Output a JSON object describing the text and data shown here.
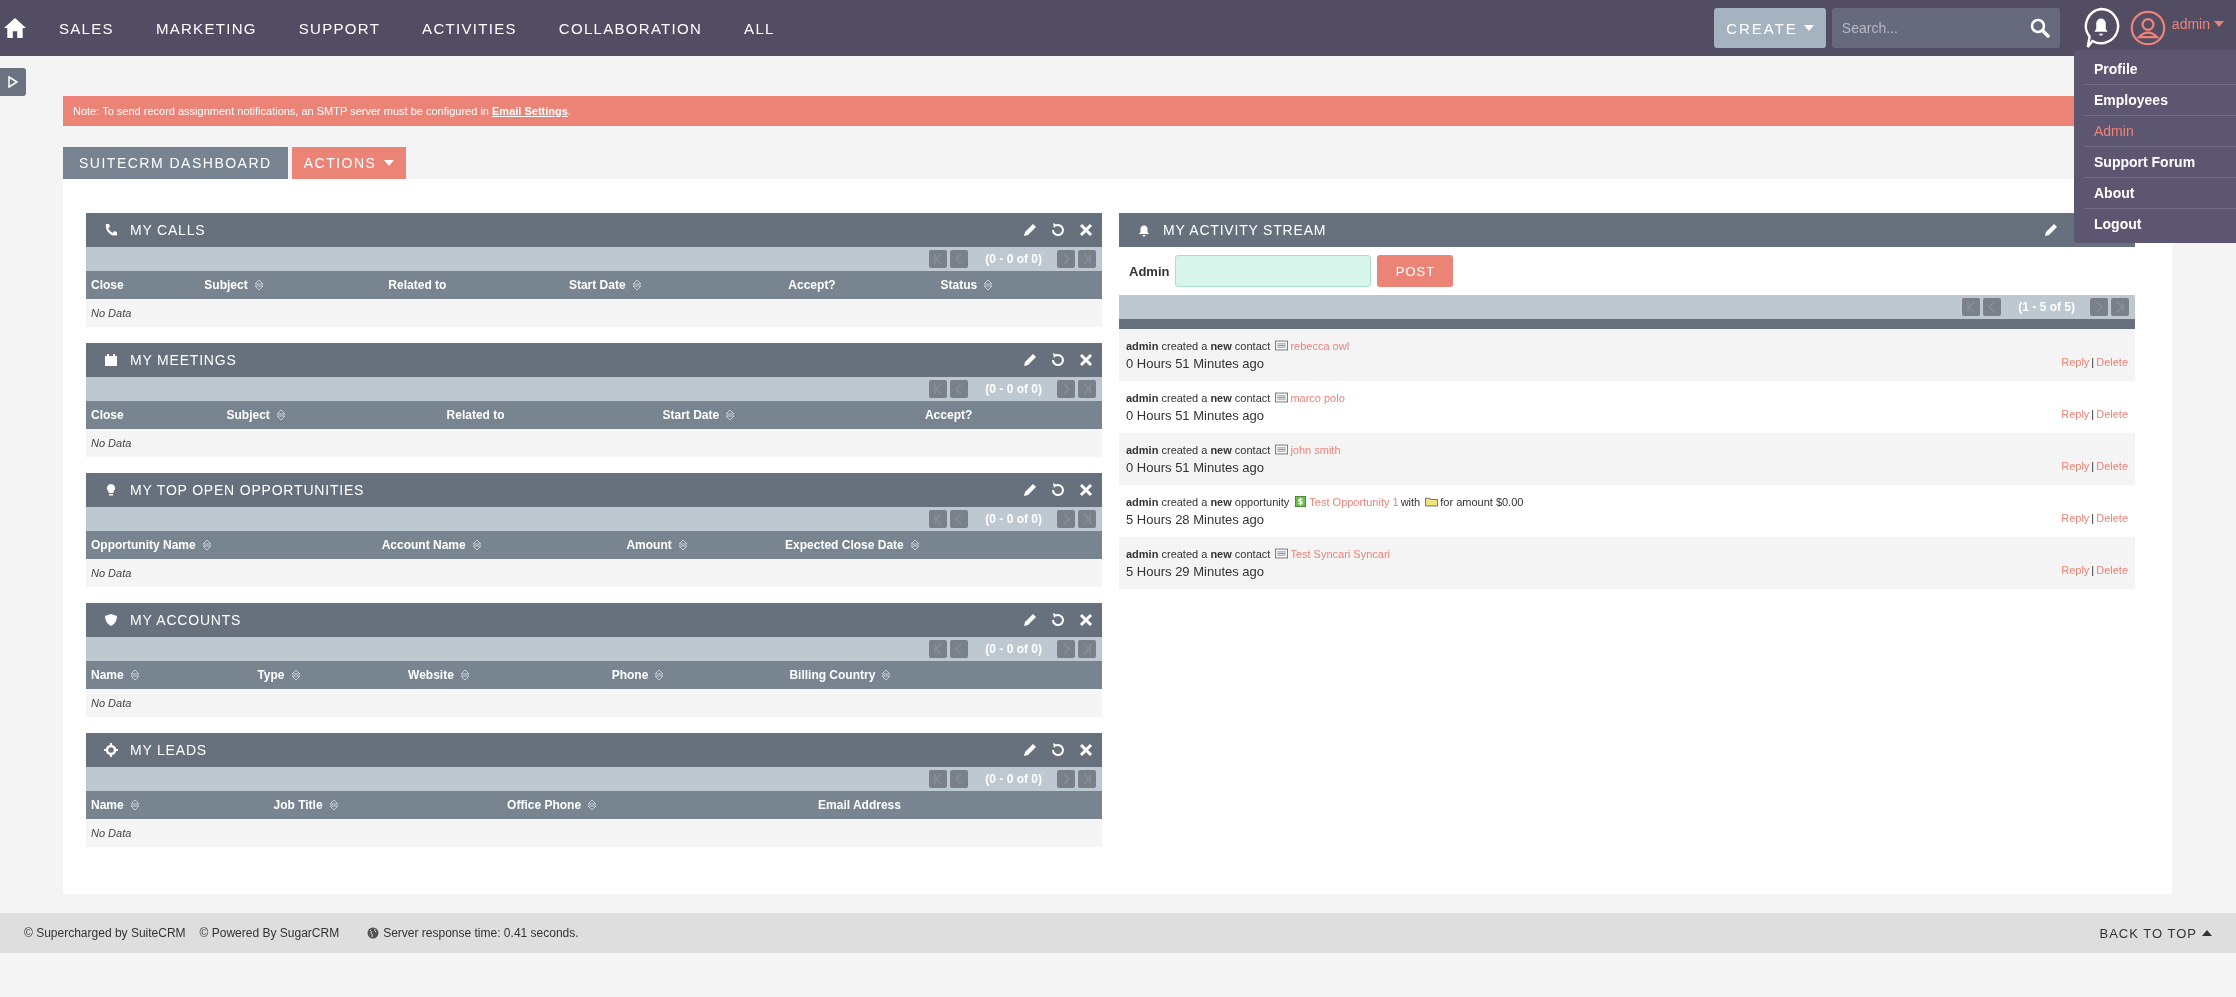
{
  "nav": {
    "items": [
      "SALES",
      "MARKETING",
      "SUPPORT",
      "ACTIVITIES",
      "COLLABORATION",
      "ALL"
    ],
    "create": "CREATE",
    "search_placeholder": "Search...",
    "user": "admin"
  },
  "user_menu": [
    {
      "label": "Profile",
      "selected": false
    },
    {
      "label": "Employees",
      "selected": false
    },
    {
      "label": "Admin",
      "selected": true
    },
    {
      "label": "Support Forum",
      "selected": false
    },
    {
      "label": "About",
      "selected": false
    },
    {
      "label": "Logout",
      "selected": false
    }
  ],
  "notice": {
    "text": "Note: To send record assignment notifications, an SMTP server must be configured in ",
    "link": "Email Settings",
    "after": "."
  },
  "dashboard_tabs": {
    "tab": "SUITECRM DASHBOARD",
    "actions": "ACTIONS"
  },
  "dashlets": [
    {
      "title": "MY CALLS",
      "pagination": "(0 - 0 of 0)",
      "columns": [
        {
          "label": "Close",
          "sortable": false
        },
        {
          "label": "Subject",
          "sortable": true
        },
        {
          "label": "Related to",
          "sortable": false
        },
        {
          "label": "Start Date",
          "sortable": true
        },
        {
          "label": "Accept?",
          "sortable": false
        },
        {
          "label": "Status",
          "sortable": true
        }
      ],
      "empty": "No Data"
    },
    {
      "title": "MY MEETINGS",
      "pagination": "(0 - 0 of 0)",
      "columns": [
        {
          "label": "Close",
          "sortable": false
        },
        {
          "label": "Subject",
          "sortable": true
        },
        {
          "label": "Related to",
          "sortable": false
        },
        {
          "label": "Start Date",
          "sortable": true
        },
        {
          "label": "Accept?",
          "sortable": false
        }
      ],
      "empty": "No Data"
    },
    {
      "title": "MY TOP OPEN OPPORTUNITIES",
      "pagination": "(0 - 0 of 0)",
      "columns": [
        {
          "label": "Opportunity Name",
          "sortable": true
        },
        {
          "label": "Account Name",
          "sortable": true
        },
        {
          "label": "Amount",
          "sortable": true
        },
        {
          "label": "Expected Close Date",
          "sortable": true
        }
      ],
      "empty": "No Data"
    },
    {
      "title": "MY ACCOUNTS",
      "pagination": "(0 - 0 of 0)",
      "columns": [
        {
          "label": "Name",
          "sortable": true
        },
        {
          "label": "Type",
          "sortable": true
        },
        {
          "label": "Website",
          "sortable": true
        },
        {
          "label": "Phone",
          "sortable": true
        },
        {
          "label": "Billing Country",
          "sortable": true
        }
      ],
      "empty": "No Data"
    },
    {
      "title": "MY LEADS",
      "pagination": "(0 - 0 of 0)",
      "columns": [
        {
          "label": "Name",
          "sortable": true
        },
        {
          "label": "Job Title",
          "sortable": true
        },
        {
          "label": "Office Phone",
          "sortable": true
        },
        {
          "label": "Email Address",
          "sortable": false
        }
      ],
      "empty": "No Data"
    }
  ],
  "activity_stream": {
    "title": "MY ACTIVITY STREAM",
    "post_label": "Admin",
    "post_button": "POST",
    "pagination": "(1 - 5 of 5)",
    "entries": [
      {
        "segments": [
          {
            "kind": "text",
            "text": "**admin** created a **new** contact"
          },
          {
            "kind": "card"
          },
          {
            "kind": "link",
            "text": "rebecca owl"
          }
        ],
        "time": "0 Hours 51 Minutes ago",
        "reply": "Reply",
        "separator": "|",
        "delete": "Delete"
      },
      {
        "segments": [
          {
            "kind": "text",
            "text": "**admin** created a **new** contact"
          },
          {
            "kind": "card"
          },
          {
            "kind": "link",
            "text": "marco polo"
          }
        ],
        "time": "0 Hours 51 Minutes ago",
        "reply": "Reply",
        "separator": "|",
        "delete": "Delete"
      },
      {
        "segments": [
          {
            "kind": "text",
            "text": "**admin** created a **new** contact"
          },
          {
            "kind": "card"
          },
          {
            "kind": "link",
            "text": "john smith"
          }
        ],
        "time": "0 Hours 51 Minutes ago",
        "reply": "Reply",
        "separator": "|",
        "delete": "Delete"
      },
      {
        "segments": [
          {
            "kind": "text",
            "text": "**admin** created a **new** opportunity"
          },
          {
            "kind": "money"
          },
          {
            "kind": "link",
            "text": "Test Opportunity 1"
          },
          {
            "kind": "text",
            "text": "with"
          },
          {
            "kind": "folder"
          },
          {
            "kind": "text",
            "text": "for amount $0.00"
          }
        ],
        "time": "5 Hours 28 Minutes ago",
        "reply": "Reply",
        "separator": "|",
        "delete": "Delete"
      },
      {
        "segments": [
          {
            "kind": "text",
            "text": "**admin** created a **new** contact"
          },
          {
            "kind": "card"
          },
          {
            "kind": "link",
            "text": "Test Syncari Syncari"
          }
        ],
        "time": "5 Hours 29 Minutes ago",
        "reply": "Reply",
        "separator": "|",
        "delete": "Delete"
      }
    ]
  },
  "footer": {
    "left": [
      "© Supercharged by SuiteCRM",
      "© Powered By SugarCRM"
    ],
    "response": "Server response time: 0.41 seconds.",
    "back_to_top": "BACK TO TOP"
  }
}
